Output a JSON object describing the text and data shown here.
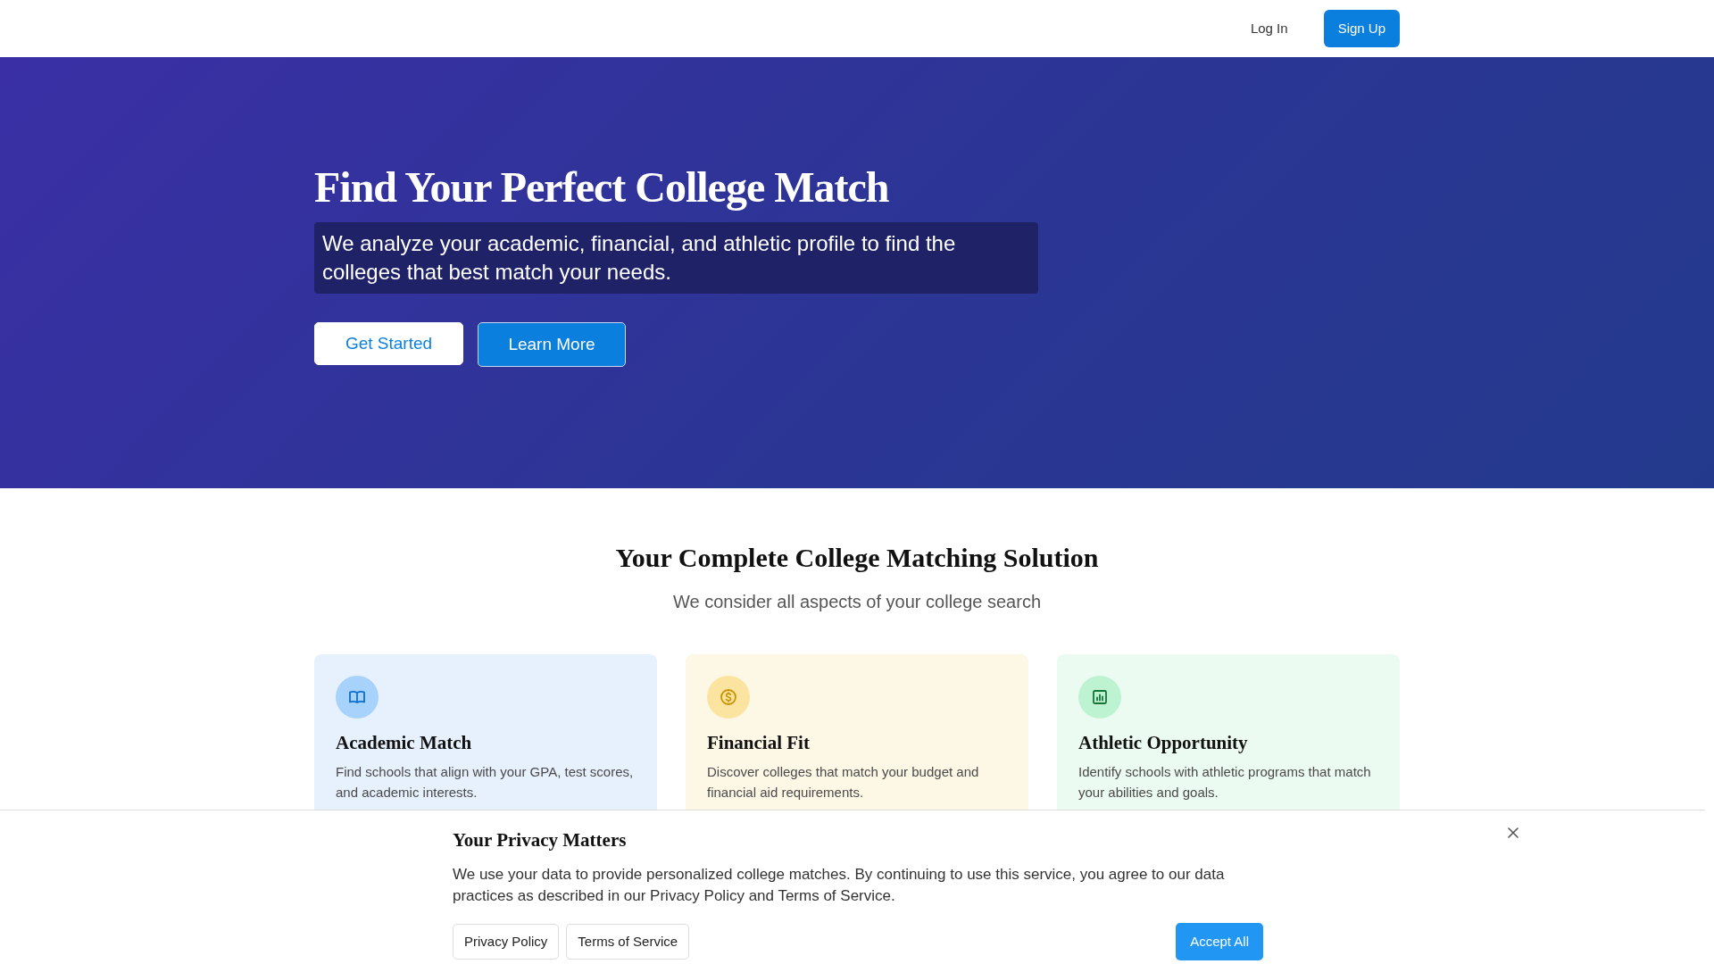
{
  "navbar": {
    "links": [
      {
        "label": "Log In",
        "kind": "link"
      },
      {
        "label": "Sign Up",
        "kind": "primary"
      }
    ]
  },
  "hero": {
    "title": "Find Your Perfect College Match",
    "subtitle": "We analyze your academic, financial, and athletic profile to find the colleges that best match your needs.",
    "buttons": [
      {
        "label": "Get Started",
        "kind": "light"
      },
      {
        "label": "Learn More",
        "kind": "primary"
      }
    ]
  },
  "features": {
    "title": "Your Complete College Matching Solution",
    "subtitle": "We consider all aspects of your college search",
    "cards": [
      {
        "kind": "academic",
        "title": "Academic Match",
        "text": "Find schools that align with your GPA, test scores, and academic interests."
      },
      {
        "kind": "financial",
        "title": "Financial Fit",
        "text": "Discover colleges that match your budget and financial aid requirements."
      },
      {
        "kind": "athletic",
        "title": "Athletic Opportunity",
        "text": "Identify schools with athletic programs that match your abilities and goals."
      }
    ]
  },
  "cookie_banner": {
    "title": "Your Privacy Matters",
    "text": "We use your data to provide personalized college matches. By continuing to use this service, you agree to our data practices as described in our Privacy Policy and Terms of Service.",
    "links": [
      "Privacy Policy",
      "Terms of Service"
    ],
    "accept": "Accept All"
  }
}
